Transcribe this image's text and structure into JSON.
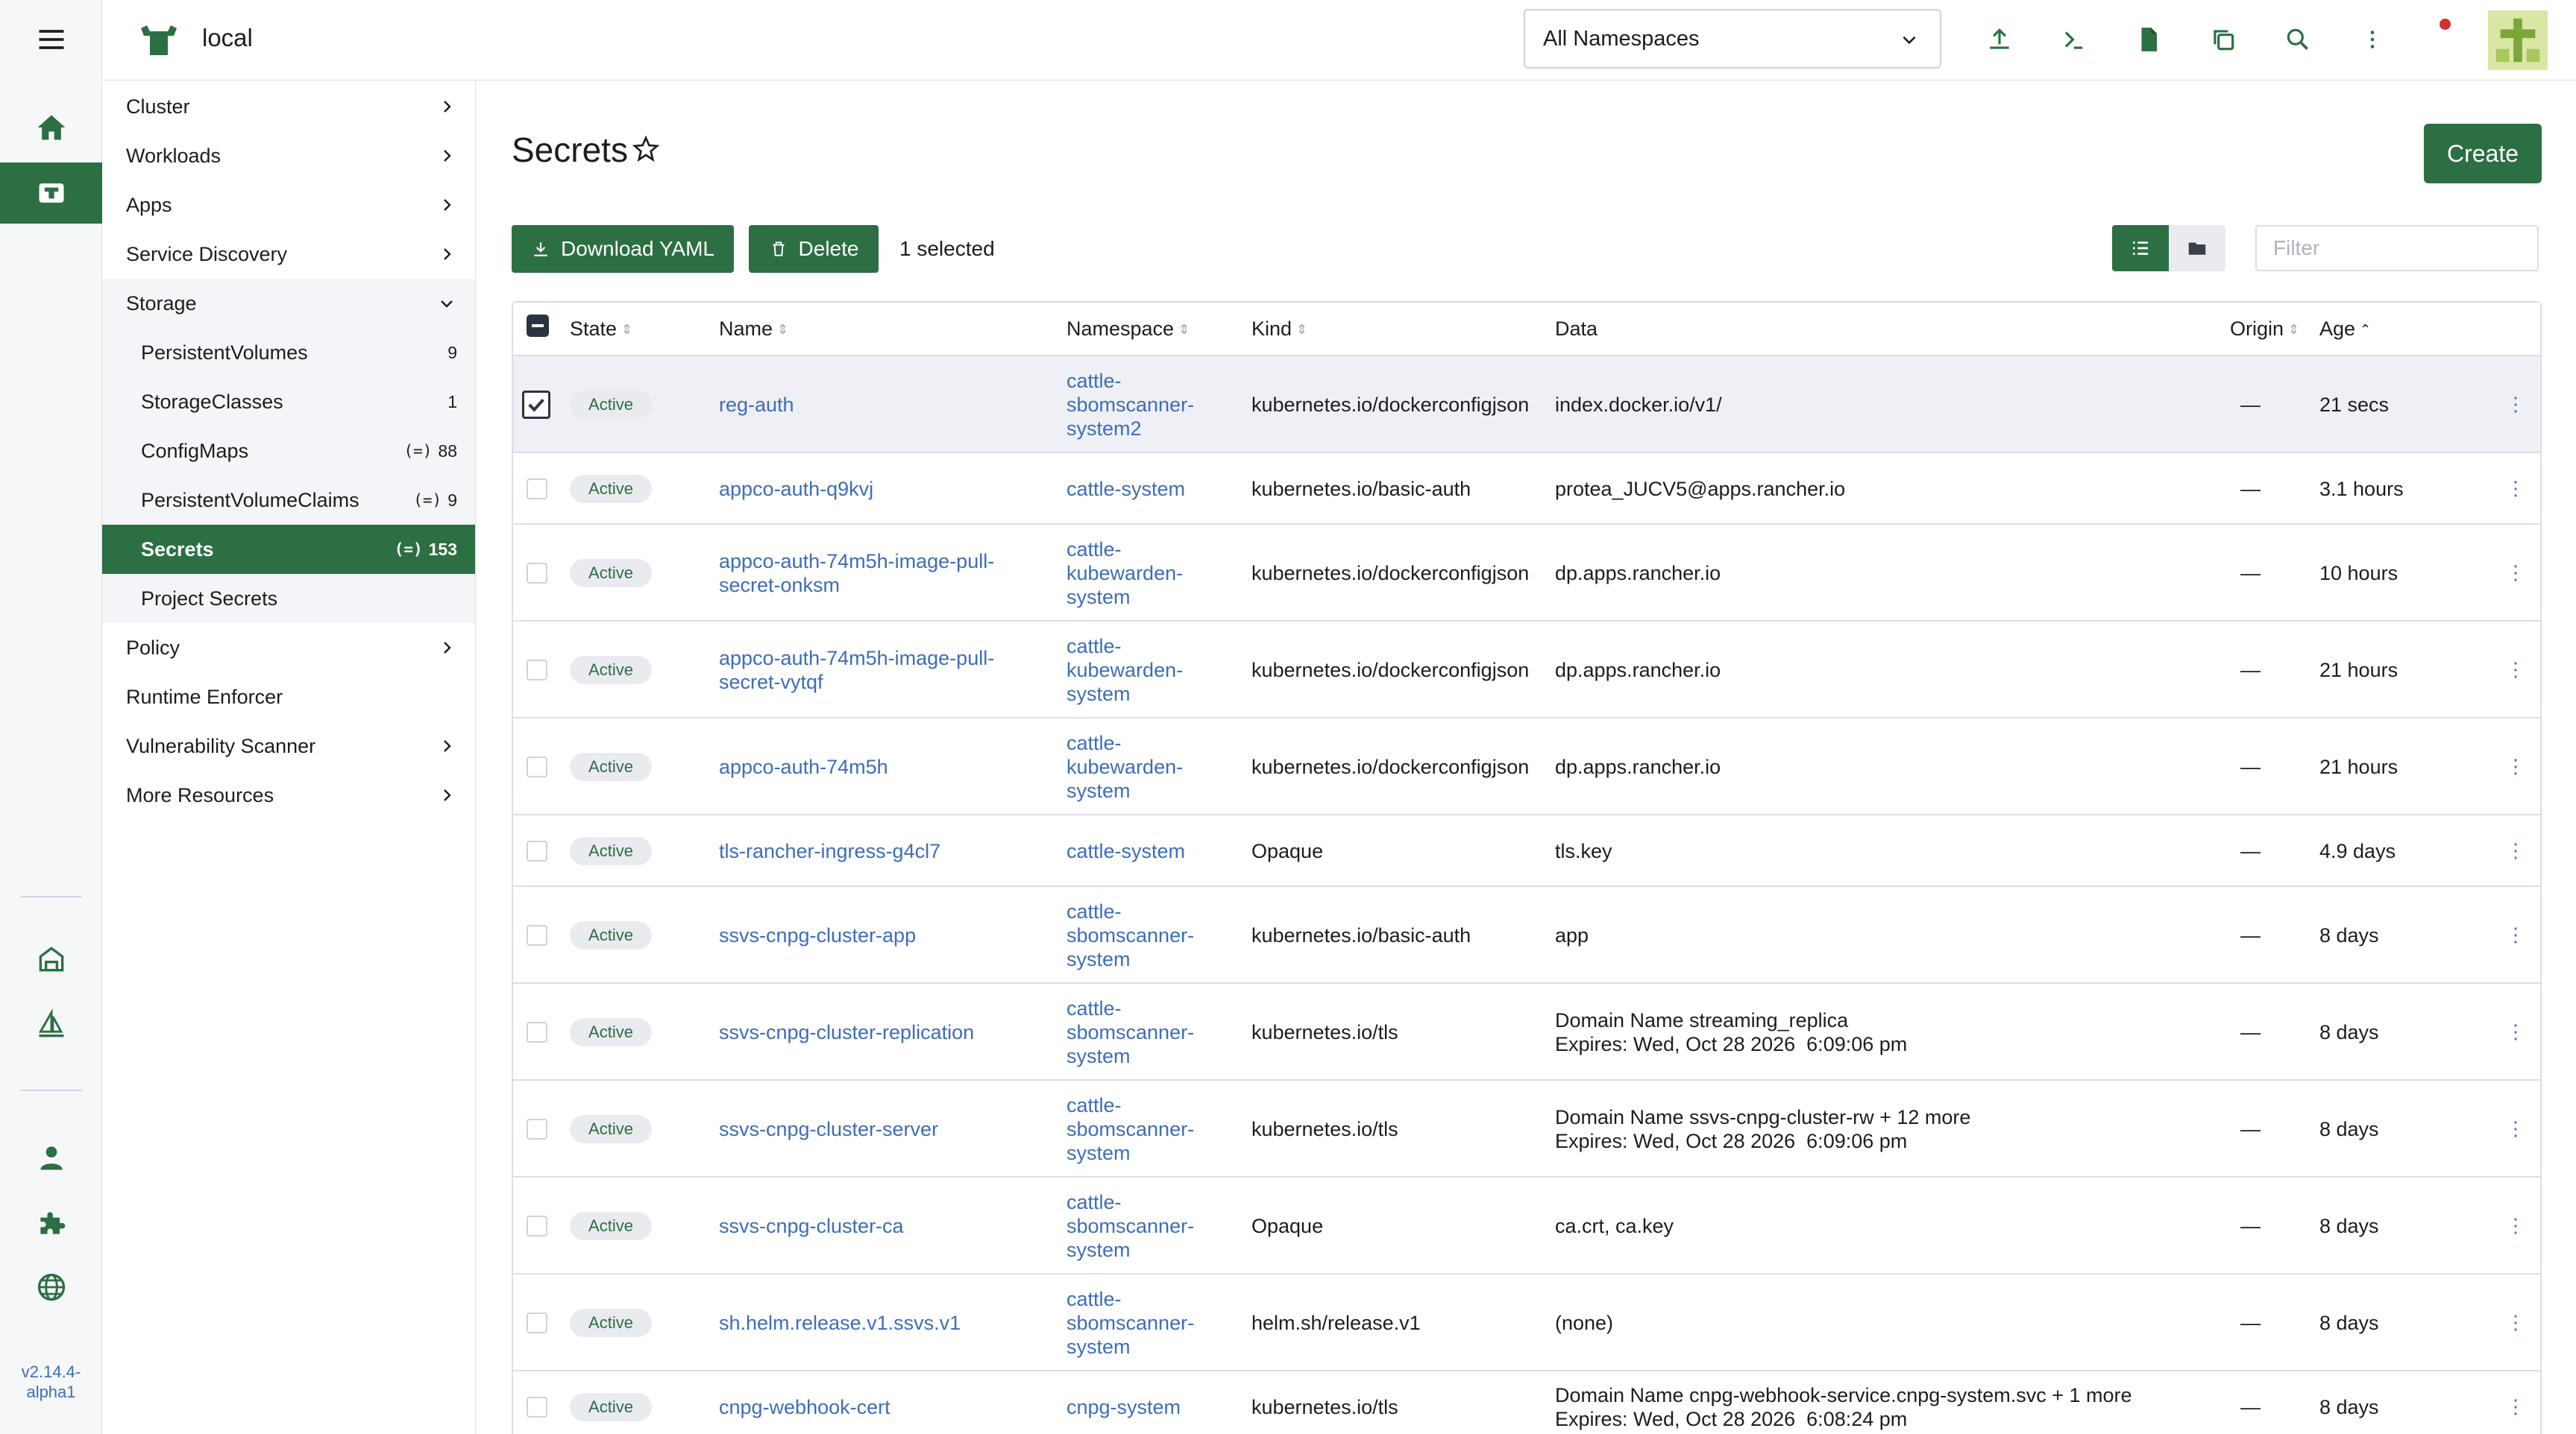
{
  "version": "v2.14.4-alpha1",
  "header": {
    "cluster_name": "local",
    "namespace_selector": "All Namespaces"
  },
  "sidebar": {
    "items": [
      {
        "label": "Cluster",
        "chevron": "right"
      },
      {
        "label": "Workloads",
        "chevron": "right"
      },
      {
        "label": "Apps",
        "chevron": "right"
      },
      {
        "label": "Service Discovery",
        "chevron": "right"
      },
      {
        "label": "Storage",
        "chevron": "down"
      },
      {
        "label": "PersistentVolumes",
        "count": "9"
      },
      {
        "label": "StorageClasses",
        "count": "1"
      },
      {
        "label": "ConfigMaps",
        "count": "88",
        "namespaced": true
      },
      {
        "label": "PersistentVolumeClaims",
        "count": "9",
        "namespaced": true
      },
      {
        "label": "Secrets",
        "count": "153",
        "namespaced": true,
        "active": true
      },
      {
        "label": "Project Secrets"
      },
      {
        "label": "Policy",
        "chevron": "right"
      },
      {
        "label": "Runtime Enforcer"
      },
      {
        "label": "Vulnerability Scanner",
        "chevron": "right"
      },
      {
        "label": "More Resources",
        "chevron": "right"
      }
    ]
  },
  "page": {
    "title": "Secrets",
    "create_label": "Create",
    "download_label": "Download YAML",
    "delete_label": "Delete",
    "selected_text": "1 selected",
    "filter_placeholder": "Filter"
  },
  "table": {
    "columns": [
      "State",
      "Name",
      "Namespace",
      "Kind",
      "Data",
      "Origin",
      "Age"
    ],
    "rows": [
      {
        "selected": true,
        "state": "Active",
        "name": "reg-auth",
        "namespace": "cattle-sbomscanner-system2",
        "kind": "kubernetes.io/dockerconfigjson",
        "data": "index.docker.io/v1/",
        "data2": "",
        "origin": "—",
        "age": "21 secs"
      },
      {
        "state": "Active",
        "name": "appco-auth-q9kvj",
        "namespace": "cattle-system",
        "kind": "kubernetes.io/basic-auth",
        "data": "protea_JUCV5@apps.rancher.io",
        "data2": "",
        "origin": "—",
        "age": "3.1 hours"
      },
      {
        "state": "Active",
        "name": "appco-auth-74m5h-image-pull-secret-onksm",
        "namespace": "cattle-kubewarden-system",
        "kind": "kubernetes.io/dockerconfigjson",
        "data": "dp.apps.rancher.io",
        "data2": "",
        "origin": "—",
        "age": "10 hours"
      },
      {
        "state": "Active",
        "name": "appco-auth-74m5h-image-pull-secret-vytqf",
        "namespace": "cattle-kubewarden-system",
        "kind": "kubernetes.io/dockerconfigjson",
        "data": "dp.apps.rancher.io",
        "data2": "",
        "origin": "—",
        "age": "21 hours"
      },
      {
        "state": "Active",
        "name": "appco-auth-74m5h",
        "namespace": "cattle-kubewarden-system",
        "kind": "kubernetes.io/dockerconfigjson",
        "data": "dp.apps.rancher.io",
        "data2": "",
        "origin": "—",
        "age": "21 hours"
      },
      {
        "state": "Active",
        "name": "tls-rancher-ingress-g4cl7",
        "namespace": "cattle-system",
        "kind": "Opaque",
        "data": "tls.key",
        "data2": "",
        "origin": "—",
        "age": "4.9 days"
      },
      {
        "state": "Active",
        "name": "ssvs-cnpg-cluster-app",
        "namespace": "cattle-sbomscanner-system",
        "kind": "kubernetes.io/basic-auth",
        "data": "app",
        "data2": "",
        "origin": "—",
        "age": "8 days"
      },
      {
        "state": "Active",
        "name": "ssvs-cnpg-cluster-replication",
        "namespace": "cattle-sbomscanner-system",
        "kind": "kubernetes.io/tls",
        "data": "Domain Name streaming_replica",
        "data2": "Expires: Wed, Oct 28 2026  6:09:06 pm",
        "origin": "—",
        "age": "8 days"
      },
      {
        "state": "Active",
        "name": "ssvs-cnpg-cluster-server",
        "namespace": "cattle-sbomscanner-system",
        "kind": "kubernetes.io/tls",
        "data": "Domain Name ssvs-cnpg-cluster-rw + 12 more",
        "data2": "Expires: Wed, Oct 28 2026  6:09:06 pm",
        "origin": "—",
        "age": "8 days"
      },
      {
        "state": "Active",
        "name": "ssvs-cnpg-cluster-ca",
        "namespace": "cattle-sbomscanner-system",
        "kind": "Opaque",
        "data": "ca.crt, ca.key",
        "data2": "",
        "origin": "—",
        "age": "8 days"
      },
      {
        "state": "Active",
        "name": "sh.helm.release.v1.ssvs.v1",
        "namespace": "cattle-sbomscanner-system",
        "kind": "helm.sh/release.v1",
        "data": "(none)",
        "data2": "",
        "origin": "—",
        "age": "8 days"
      },
      {
        "state": "Active",
        "name": "cnpg-webhook-cert",
        "namespace": "cnpg-system",
        "kind": "kubernetes.io/tls",
        "data": "Domain Name cnpg-webhook-service.cnpg-system.svc + 1 more",
        "data2": "Expires: Wed, Oct 28 2026  6:08:24 pm",
        "origin": "—",
        "age": "8 days"
      }
    ]
  },
  "colors": {
    "accent": "#2b6f42",
    "link": "#3d6dba",
    "border": "#dcdee7"
  }
}
